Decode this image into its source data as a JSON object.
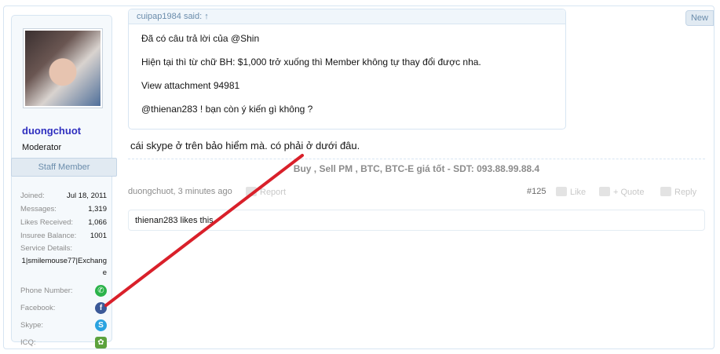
{
  "post": {
    "new_badge": "New",
    "user": {
      "name": "duongchuot",
      "title": "Moderator",
      "staff_label": "Staff Member",
      "stats": [
        {
          "label": "Joined:",
          "value": "Jul 18, 2011"
        },
        {
          "label": "Messages:",
          "value": "1,319"
        },
        {
          "label": "Likes Received:",
          "value": "1,066"
        },
        {
          "label": "Insuree Balance:",
          "value": "1001"
        }
      ],
      "service_label": "Service Details:",
      "service_value": "1|smilemouse77|Exchange",
      "identities": [
        {
          "label": "Phone Number:",
          "icon": "phone-icon",
          "glyph": "✆"
        },
        {
          "label": "Facebook:",
          "icon": "facebook-icon",
          "glyph": "f"
        },
        {
          "label": "Skype:",
          "icon": "skype-icon",
          "glyph": "S"
        },
        {
          "label": "ICQ:",
          "icon": "icq-icon",
          "glyph": "✿"
        }
      ]
    },
    "quote": {
      "author": "cuipap1984 said: ↑",
      "lines": [
        "Đã có câu trả lời của @Shin",
        "Hiện tại thì từ chữ BH: $1,000 trở xuống thì Member không tự thay đổi được nha.",
        "View attachment 94981",
        "@thienan283 ! bạn còn ý kiến gì không ?"
      ]
    },
    "message": "cái skype ở trên bảo hiểm mà. có phải ở dưới đâu.",
    "signature": "Buy , Sell PM , BTC, BTC-E giá tốt - SDT: 093.88.99.88.4",
    "meta": {
      "author_date": "duongchuot, 3 minutes ago",
      "report": "Report",
      "post_number": "#125",
      "like": "Like",
      "quote": "+ Quote",
      "reply": "Reply"
    },
    "likes_summary": "thienan283 likes this."
  },
  "colors": {
    "username": "#2f2fbf",
    "border": "#d7e5f2",
    "staff_bg": "#e1eaf2",
    "annotation_line": "#d9202a"
  }
}
